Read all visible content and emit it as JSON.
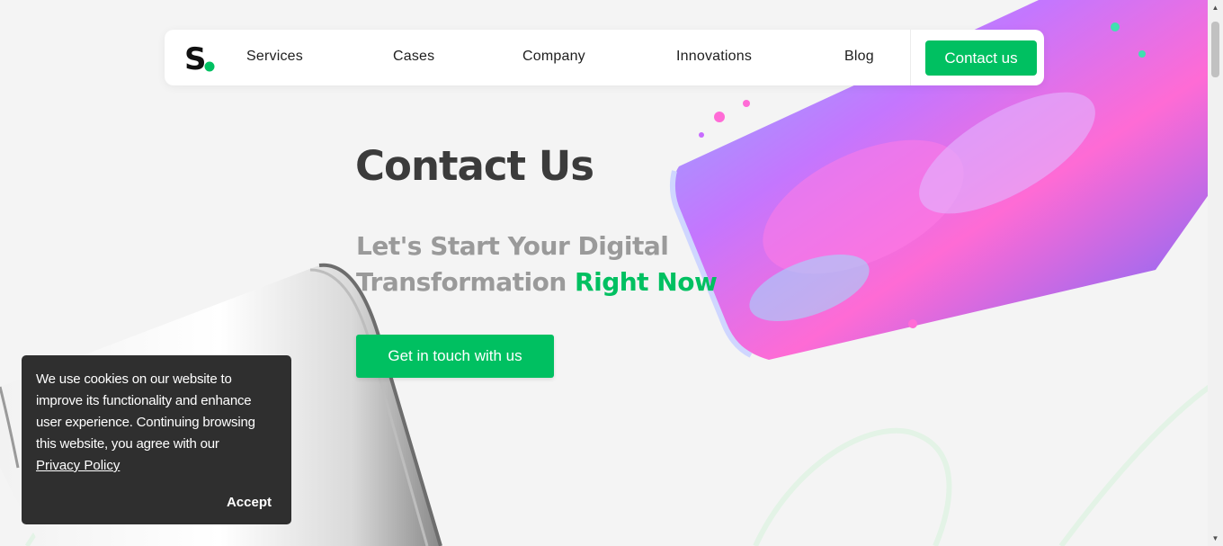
{
  "nav": {
    "items": [
      {
        "label": "Services"
      },
      {
        "label": "Cases"
      },
      {
        "label": "Company"
      },
      {
        "label": "Innovations"
      },
      {
        "label": "Blog"
      }
    ],
    "contact_label": "Contact us"
  },
  "hero": {
    "title": "Contact Us",
    "subtitle_line1": "Let's Start Your Digital",
    "subtitle_line2": "Transformation",
    "subtitle_accent": "Right Now",
    "cta_label": "Get in touch with us"
  },
  "cookie": {
    "text": "We use cookies on our website to improve its functionality and enhance user experience. Continuing browsing this website, you agree with our",
    "link_label": "Privacy Policy",
    "accept_label": "Accept"
  },
  "colors": {
    "accent": "#00c061",
    "title": "#3b3b3b",
    "subtitle": "#9a9a9a",
    "cookie_bg": "#2f2f2f",
    "background": "#f4f4f4"
  },
  "icons": {
    "logo": "s-dot-logo",
    "scroll_up": "triangle-up-icon",
    "scroll_down": "triangle-down-icon"
  }
}
